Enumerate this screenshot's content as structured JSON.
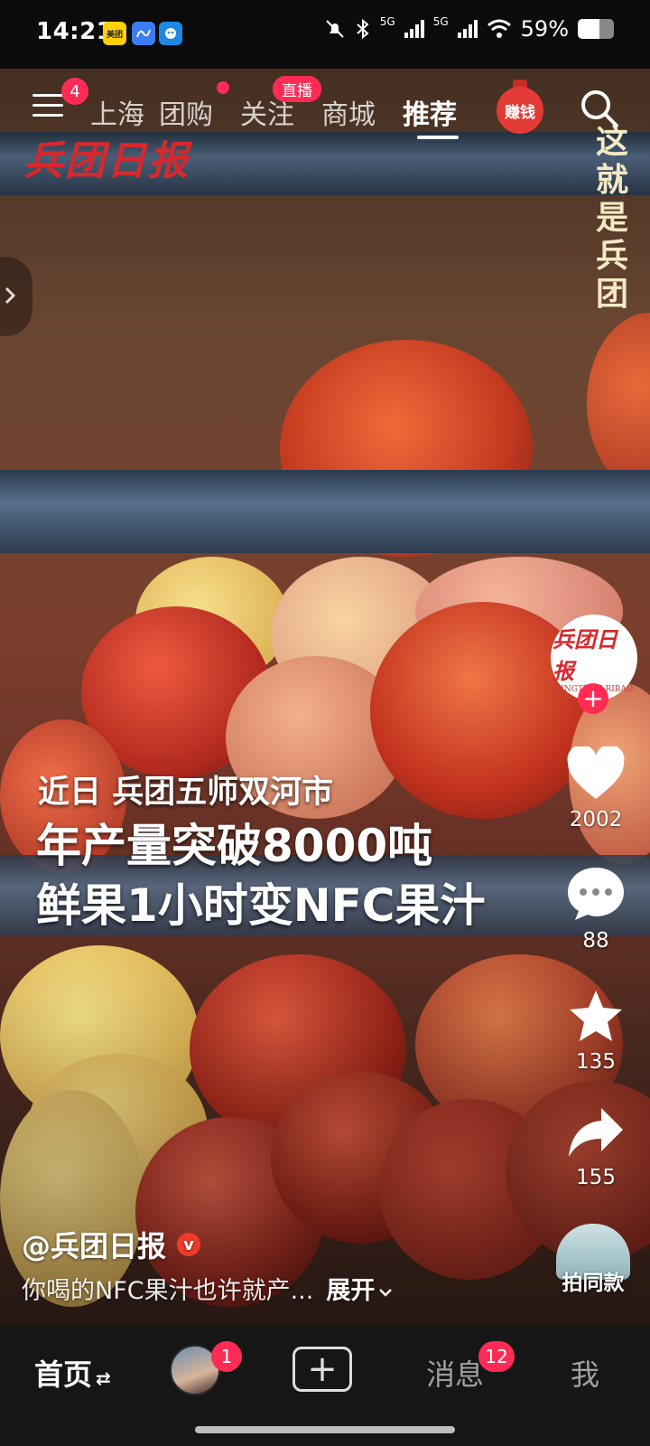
{
  "status_bar": {
    "time": "14:21",
    "apps": [
      "美团",
      "app-icon-2",
      "app-icon-3"
    ],
    "signal1": "5G",
    "signal2": "5G",
    "battery_text": "59%",
    "battery_level": 0.59
  },
  "top_nav": {
    "menu_badge": "4",
    "tabs": [
      "上海",
      "团购",
      "关注",
      "商城",
      "推荐"
    ],
    "active_tab": "推荐",
    "live_badge": "直播",
    "money_label": "赚钱"
  },
  "overlay": {
    "logo_text": "兵团日报",
    "vertical_title": "这就是兵团"
  },
  "video": {
    "caption_line1": "近日 兵团五师双河市",
    "caption_line2": "年产量突破8000吨",
    "caption_line3": "鲜果1小时变NFC果汁"
  },
  "rail": {
    "avatar_text": "兵团日报",
    "avatar_sub": "BINGTUAN RIBAO",
    "follow_symbol": "+",
    "likes": "2002",
    "comments": "88",
    "favorites": "135",
    "shares": "155"
  },
  "post": {
    "author": "@兵团日报",
    "verified_mark": "v",
    "description": "你喝的NFC果汁也许就产...",
    "expand_label": "展开",
    "same_style_label": "拍同款"
  },
  "bottom_nav": {
    "home_label": "首页",
    "home_arrows": "⇄",
    "friend_badge": "1",
    "plus_symbol": "+",
    "messages_label": "消息",
    "messages_badge": "12",
    "me_label": "我"
  },
  "colors": {
    "accent": "#fe2c55",
    "logo_red": "#d8282d",
    "title_cream": "#f3e9c4"
  }
}
